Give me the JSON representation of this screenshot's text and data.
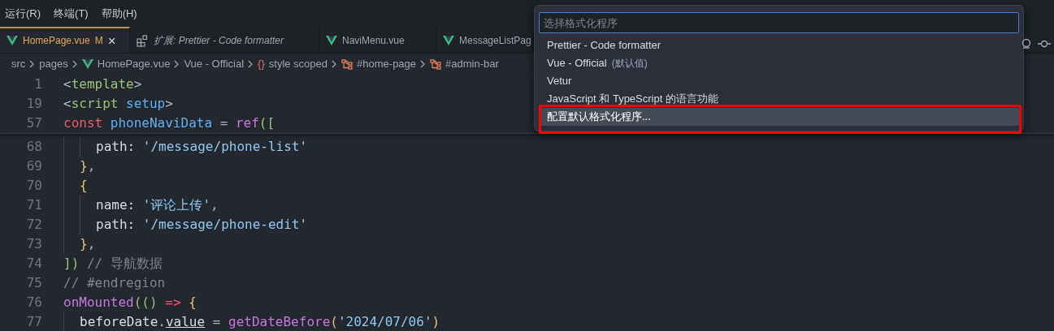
{
  "menu": [
    {
      "label": "运行(R)"
    },
    {
      "label": "终端(T)"
    },
    {
      "label": "帮助(H)"
    }
  ],
  "tabs": [
    {
      "label": "HomePage.vue",
      "kind": "vue",
      "selected": true,
      "badge": "M",
      "close": "×",
      "italic": false
    },
    {
      "label": "扩展: Prettier - Code formatter",
      "kind": "extension",
      "selected": false,
      "italic": true
    },
    {
      "label": "NaviMenu.vue",
      "kind": "vue",
      "selected": false,
      "italic": false
    },
    {
      "label": "MessageListPag",
      "kind": "vue",
      "selected": false,
      "italic": false
    }
  ],
  "breadcrumbs": [
    {
      "label": "src",
      "kind": "folder"
    },
    {
      "label": "pages",
      "kind": "folder"
    },
    {
      "label": "HomePage.vue",
      "kind": "vue"
    },
    {
      "label": "Vue - Official",
      "kind": "plain"
    },
    {
      "label": "style scoped",
      "kind": "braces",
      "symbol": "{}"
    },
    {
      "label": "#home-page",
      "kind": "selector"
    },
    {
      "label": "#admin-bar",
      "kind": "selector"
    }
  ],
  "sticky_lines": [
    {
      "number": "1",
      "tokens": [
        {
          "text": "<",
          "kind": "punct"
        },
        {
          "text": "template",
          "kind": "tag"
        },
        {
          "text": ">",
          "kind": "punct"
        }
      ]
    },
    {
      "number": "19",
      "tokens": [
        {
          "text": "<",
          "kind": "punct"
        },
        {
          "text": "script",
          "kind": "tag"
        },
        {
          "text": " setup",
          "kind": "attr"
        },
        {
          "text": ">",
          "kind": "punct"
        }
      ]
    },
    {
      "number": "57",
      "tokens": [
        {
          "text": "const",
          "kind": "kw"
        },
        {
          "text": " phoneNaviData",
          "kind": "var"
        },
        {
          "text": " = ",
          "kind": "plain"
        },
        {
          "text": "ref",
          "kind": "fn"
        },
        {
          "text": "([",
          "kind": "paren"
        }
      ]
    }
  ],
  "code_lines": [
    {
      "children": [
        {
          "children": [
            {
              "number": "68",
              "tokens": [
                {
                  "text": "path: ",
                  "kind": "prop"
                },
                {
                  "text": "'/message/phone-list'",
                  "kind": "str"
                }
              ]
            }
          ]
        },
        {
          "number": "69",
          "tokens": [
            {
              "text": "}",
              "kind": "brace"
            },
            {
              "text": ",",
              "kind": "plain"
            }
          ]
        },
        {
          "number": "70",
          "tokens": [
            {
              "text": "{",
              "kind": "brace"
            }
          ],
          "children": [
            {
              "number": "71",
              "tokens": [
                {
                  "text": "name: ",
                  "kind": "prop"
                },
                {
                  "text": "'评论上传'",
                  "kind": "str"
                },
                {
                  "text": ",",
                  "kind": "plain"
                }
              ]
            },
            {
              "number": "72",
              "tokens": [
                {
                  "text": "path: ",
                  "kind": "prop"
                },
                {
                  "text": "'/message/phone-edit'",
                  "kind": "str"
                }
              ]
            }
          ]
        },
        {
          "number": "73",
          "tokens": [
            {
              "text": "}",
              "kind": "brace"
            },
            {
              "text": ",",
              "kind": "plain"
            }
          ]
        }
      ]
    },
    {
      "number": "74",
      "tokens": [
        {
          "text": "])",
          "kind": "paren"
        },
        {
          "text": " // 导航数据",
          "kind": "cmt"
        }
      ]
    },
    {
      "number": "75",
      "tokens": [
        {
          "text": "// #endregion",
          "kind": "cmt"
        }
      ]
    },
    {
      "number": "76",
      "tokens": [
        {
          "text": "onMounted",
          "kind": "fn"
        },
        {
          "text": "(()",
          "kind": "paren"
        },
        {
          "text": " => ",
          "kind": "kw"
        },
        {
          "text": "{",
          "kind": "brace"
        }
      ],
      "children": [
        {
          "number": "77",
          "tokens": [
            {
              "text": "beforeDate",
              "kind": "prop"
            },
            {
              "text": ".",
              "kind": "plain"
            },
            {
              "text": "value",
              "kind": "link"
            },
            {
              "text": " = ",
              "kind": "plain"
            },
            {
              "text": "getDateBefore",
              "kind": "fn"
            },
            {
              "text": "(",
              "kind": "brace"
            },
            {
              "text": "'2024/07/06'",
              "kind": "str"
            },
            {
              "text": ")",
              "kind": "brace"
            }
          ]
        }
      ]
    }
  ],
  "formatter_picker": {
    "placeholder": "选择格式化程序",
    "items": [
      {
        "label": "Prettier - Code formatter",
        "selected": false
      },
      {
        "label": "Vue - Official",
        "note": "(默认值)",
        "selected": false
      },
      {
        "label": "Vetur",
        "selected": false
      },
      {
        "label": "JavaScript 和 TypeScript 的语言功能",
        "selected": false
      },
      {
        "label": "配置默认格式化程序...",
        "selected": true,
        "highlighted": true
      }
    ]
  }
}
